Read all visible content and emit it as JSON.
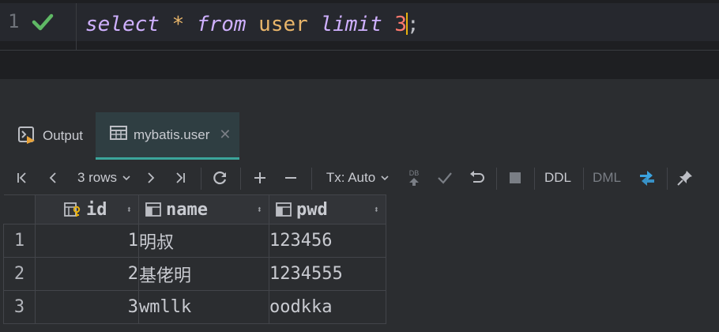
{
  "editor": {
    "line_number": "1",
    "tokens": {
      "select": "select",
      "star": "*",
      "from": "from",
      "table": "user",
      "limit": "limit",
      "count": "3",
      "semicolon": ";"
    }
  },
  "tabs": [
    {
      "label": "Output",
      "icon": "console-icon"
    },
    {
      "label": "mybatis.user",
      "icon": "table-icon",
      "active": true
    }
  ],
  "toolbar": {
    "rows_label": "3 rows",
    "tx_label": "Tx: Auto",
    "ddl_label": "DDL",
    "dml_label": "DML",
    "db_label": "DB"
  },
  "grid": {
    "columns": [
      "id",
      "name",
      "pwd"
    ],
    "rows": [
      {
        "num": "1",
        "id": "1",
        "name": "明叔",
        "pwd": "123456"
      },
      {
        "num": "2",
        "id": "2",
        "name": "基佬明",
        "pwd": "1234555"
      },
      {
        "num": "3",
        "id": "3",
        "name": "wmllk",
        "pwd": "oodkka"
      }
    ]
  },
  "colors": {
    "accent": "#3ba59b",
    "keyword": "#cfb0ff",
    "operator": "#e8b56a",
    "number": "#ff7a6e",
    "success": "#5fb865"
  }
}
